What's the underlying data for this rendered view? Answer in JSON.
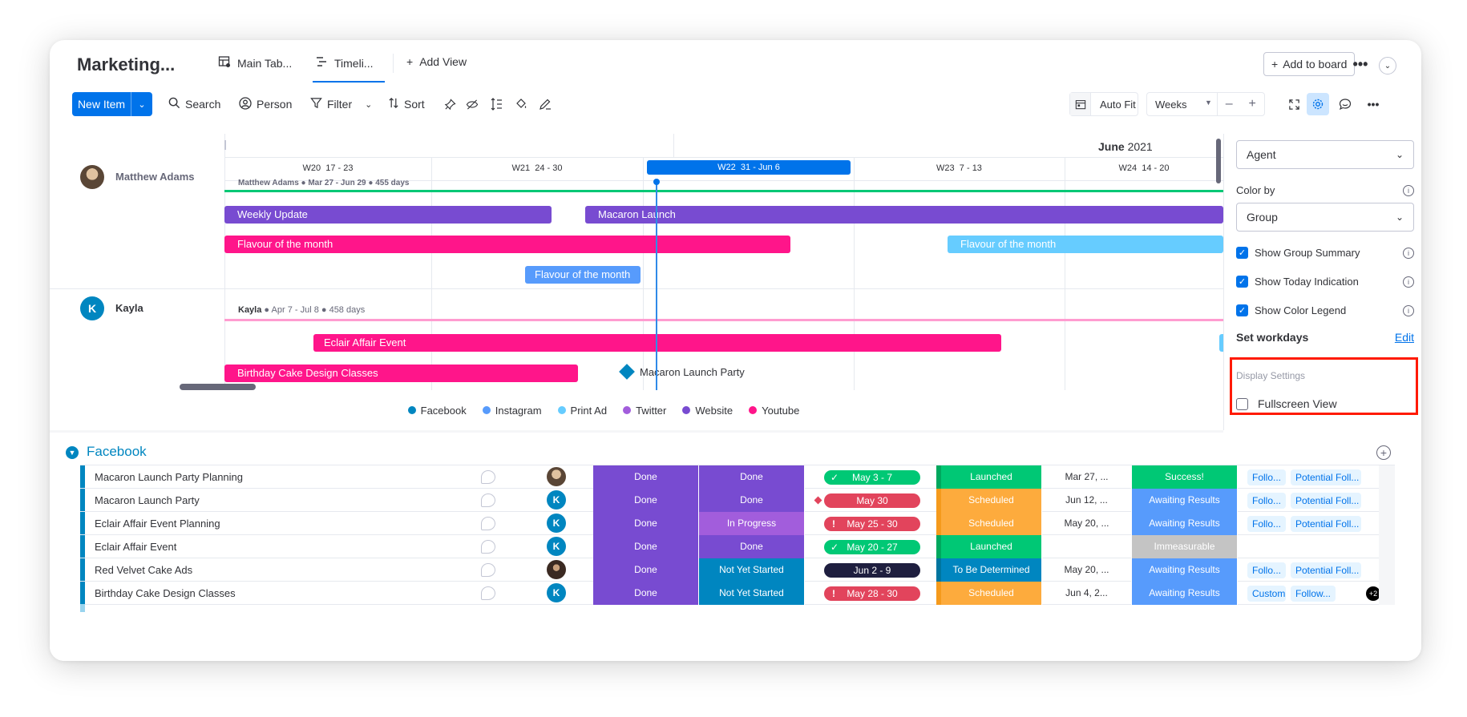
{
  "header": {
    "board_title": "Marketing...",
    "tabs": [
      {
        "label": "Main Tab...",
        "icon": "table-icon"
      },
      {
        "label": "Timeli...",
        "icon": "timeline-icon"
      }
    ],
    "add_view_label": "Add View",
    "add_to_board_label": "Add to board"
  },
  "toolbar": {
    "new_item_label": "New Item",
    "search_label": "Search",
    "person_label": "Person",
    "filter_label": "Filter",
    "sort_label": "Sort",
    "auto_fit_label": "Auto Fit",
    "scale_value": "Weeks"
  },
  "timeline": {
    "month_label": "June",
    "year_label": "2021",
    "weeks": [
      {
        "label": "W20",
        "range": "17 - 23"
      },
      {
        "label": "W21",
        "range": "24 - 30"
      },
      {
        "label": "W22",
        "range": "31 - Jun 6"
      },
      {
        "label": "W23",
        "range": "7 - 13"
      },
      {
        "label": "W24",
        "range": "14 - 20"
      }
    ],
    "groups": [
      {
        "name": "Matthew Adams",
        "summary": "Matthew Adams ● Mar 27 - Jun 29 ● 455 days",
        "bars": [
          {
            "label": "Weekly Update",
            "color": "#784bd1"
          },
          {
            "label": "Macaron Launch",
            "color": "#784bd1"
          },
          {
            "label": "Flavour of the month",
            "color": "#ff158a"
          },
          {
            "label": "Flavour of the month",
            "color": "#66ccff"
          },
          {
            "label": "Flavour of the month",
            "color": "#579bfc"
          }
        ]
      },
      {
        "name": "Kayla",
        "initial": "K",
        "summary_name": "Kayla",
        "summary": "● Apr 7 - Jul 8 ● 458 days",
        "bars": [
          {
            "label": "Eclair Affair Event",
            "color": "#ff158a"
          },
          {
            "label": "Birthday Cake Design Classes",
            "color": "#ff158a"
          },
          {
            "label": "Macaron Launch Party",
            "color": "#0086c0"
          }
        ]
      }
    ],
    "legend": [
      {
        "label": "Facebook",
        "color": "#0086c0"
      },
      {
        "label": "Instagram",
        "color": "#579bfc"
      },
      {
        "label": "Print Ad",
        "color": "#66ccff"
      },
      {
        "label": "Twitter",
        "color": "#a25ddc"
      },
      {
        "label": "Website",
        "color": "#784bd1"
      },
      {
        "label": "Youtube",
        "color": "#ff158a"
      }
    ]
  },
  "settings_panel": {
    "group_by_value": "Agent",
    "color_by_label": "Color by",
    "color_by_value": "Group",
    "checkboxes": [
      {
        "label": "Show Group Summary",
        "checked": true
      },
      {
        "label": "Show Today Indication",
        "checked": true
      },
      {
        "label": "Show Color Legend",
        "checked": true
      }
    ],
    "workdays_label": "Set workdays",
    "workdays_edit": "Edit",
    "display_settings_label": "Display Settings",
    "fullscreen_label": "Fullscreen View",
    "fullscreen_checked": false
  },
  "table": {
    "group_name": "Facebook",
    "group_color": "#0086c0",
    "rows": [
      {
        "name": "Macaron Launch Party Planning",
        "owner": "photo",
        "status1": "Done",
        "status2": "Done",
        "status2_color": "#784bd1",
        "timeline": "May 3 - 7",
        "timeline_color": "#00c875",
        "timeline_mark": "check",
        "stage": "Launched",
        "stage_color": "#00c875",
        "date": "Mar 27, ...",
        "result": "Success!",
        "result_color": "#00c875",
        "tags": [
          "Follo...",
          "Potential Foll..."
        ]
      },
      {
        "name": "Macaron Launch Party",
        "owner": "K",
        "status1": "Done",
        "status2": "Done",
        "status2_color": "#784bd1",
        "timeline": "May 30",
        "timeline_color": "#e2445c",
        "timeline_mark": "diamond",
        "stage": "Scheduled",
        "stage_color": "#fdab3d",
        "date": "Jun 12, ...",
        "result": "Awaiting Results",
        "result_color": "#579bfc",
        "tags": [
          "Follo...",
          "Potential Foll..."
        ]
      },
      {
        "name": "Eclair Affair Event Planning",
        "owner": "K",
        "status1": "Done",
        "status2": "In Progress",
        "status2_color": "#a25ddc",
        "timeline": "May 25 - 30",
        "timeline_color": "#e2445c",
        "timeline_mark": "alert",
        "stage": "Scheduled",
        "stage_color": "#fdab3d",
        "date": "May 20, ...",
        "result": "Awaiting Results",
        "result_color": "#579bfc",
        "tags": [
          "Follo...",
          "Potential Foll..."
        ]
      },
      {
        "name": "Eclair Affair Event",
        "owner": "K",
        "status1": "Done",
        "status2": "Done",
        "status2_color": "#784bd1",
        "timeline": "May 20 - 27",
        "timeline_color": "#00c875",
        "timeline_mark": "check",
        "stage": "Launched",
        "stage_color": "#00c875",
        "date": "",
        "result": "Immeasurable",
        "result_color": "#c4c4c4",
        "tags": []
      },
      {
        "name": "Red Velvet Cake Ads",
        "owner": "photo2",
        "status1": "Done",
        "status2": "Not Yet Started",
        "status2_color": "#0086c0",
        "timeline": "Jun 2 - 9",
        "timeline_color": "#1f1f3f",
        "timeline_mark": "",
        "stage": "To Be Determined",
        "stage_color": "#0086c0",
        "date": "May 20, ...",
        "result": "Awaiting Results",
        "result_color": "#579bfc",
        "tags": [
          "Follo...",
          "Potential Foll..."
        ]
      },
      {
        "name": "Birthday Cake Design Classes",
        "owner": "K",
        "status1": "Done",
        "status2": "Not Yet Started",
        "status2_color": "#0086c0",
        "timeline": "May 28 - 30",
        "timeline_color": "#e2445c",
        "timeline_mark": "alert",
        "stage": "Scheduled",
        "stage_color": "#fdab3d",
        "date": "Jun 4, 2...",
        "result": "Awaiting Results",
        "result_color": "#579bfc",
        "tags": [
          "Custom...",
          "Follow..."
        ],
        "extra_count": "+2"
      }
    ]
  }
}
